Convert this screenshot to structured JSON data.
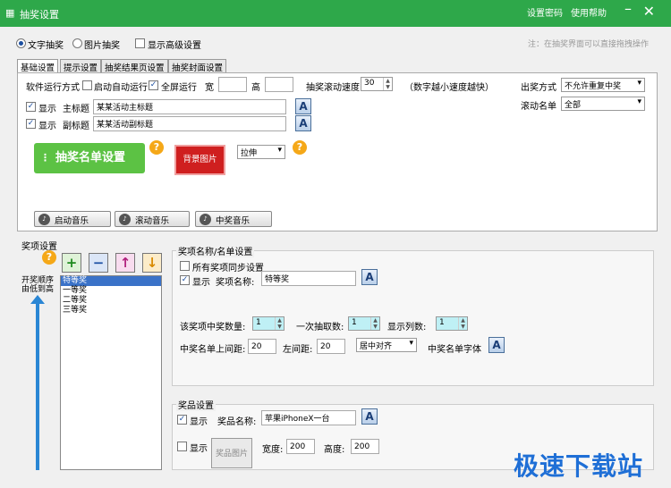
{
  "app": {
    "title": "抽奖设置",
    "links": [
      "设置密码",
      "使用帮助"
    ]
  },
  "top": {
    "radio_text": "文字抽奖",
    "radio_image": "图片抽奖",
    "advanced": "显示高级设置",
    "tip": "注：在抽奖界面可以直接拖拽操作"
  },
  "tabs": [
    "基础设置",
    "提示设置",
    "抽奖结果页设置",
    "抽奖封面设置"
  ],
  "basic": {
    "run_mode": "软件运行方式",
    "autostart": "启动自动运行",
    "fullscreen": "全屏运行",
    "width_lbl": "宽",
    "height_lbl": "高",
    "speed_lbl": "抽奖滚动速度",
    "speed": "30",
    "speed_hint": "（数字越小速度越快）",
    "show": "显示",
    "main_title_lbl": "主标题",
    "main_title": "某某活动主标题",
    "sub_title_lbl": "副标题",
    "sub_title": "某某活动副标题",
    "list_btn": "抽奖名单设置",
    "bg_btn": "背景图片",
    "stretch": "拉伸",
    "mode_lbl": "出奖方式",
    "mode": "不允许重复中奖",
    "roll_lbl": "滚动名单",
    "roll": "全部",
    "music": [
      "启动音乐",
      "滚动音乐",
      "中奖音乐"
    ]
  },
  "prize": {
    "title": "奖项设置",
    "order": "开奖顺序由低到高",
    "items": [
      "特等奖",
      "一等奖",
      "二等奖",
      "三等奖"
    ],
    "name_group": "奖项名称/名单设置",
    "sync": "所有奖项同步设置",
    "show": "显示",
    "name_lbl": "奖项名称:",
    "name": "特等奖",
    "count_lbl": "该奖项中奖数量:",
    "count": "1",
    "once_lbl": "一次抽取数:",
    "once": "1",
    "cols_lbl": "显示列数:",
    "cols": "1",
    "top_lbl": "中奖名单上间距:",
    "top": "20",
    "left_lbl": "左间距:",
    "left": "20",
    "align": "居中对齐",
    "font_lbl": "中奖名单字体"
  },
  "gift": {
    "title": "奖品设置",
    "show": "显示",
    "name_lbl": "奖品名称:",
    "name": "苹果iPhoneX一台",
    "show2": "显示",
    "img_btn": "奖品图片",
    "w_lbl": "宽度:",
    "w": "200",
    "h_lbl": "高度:",
    "h": "200"
  },
  "watermark": "极速下载站",
  "colors": {
    "title": "#2ea84a",
    "list_btn": "#5cc244",
    "bg_btn": "#cf1f1f",
    "help": "#f5a818"
  }
}
